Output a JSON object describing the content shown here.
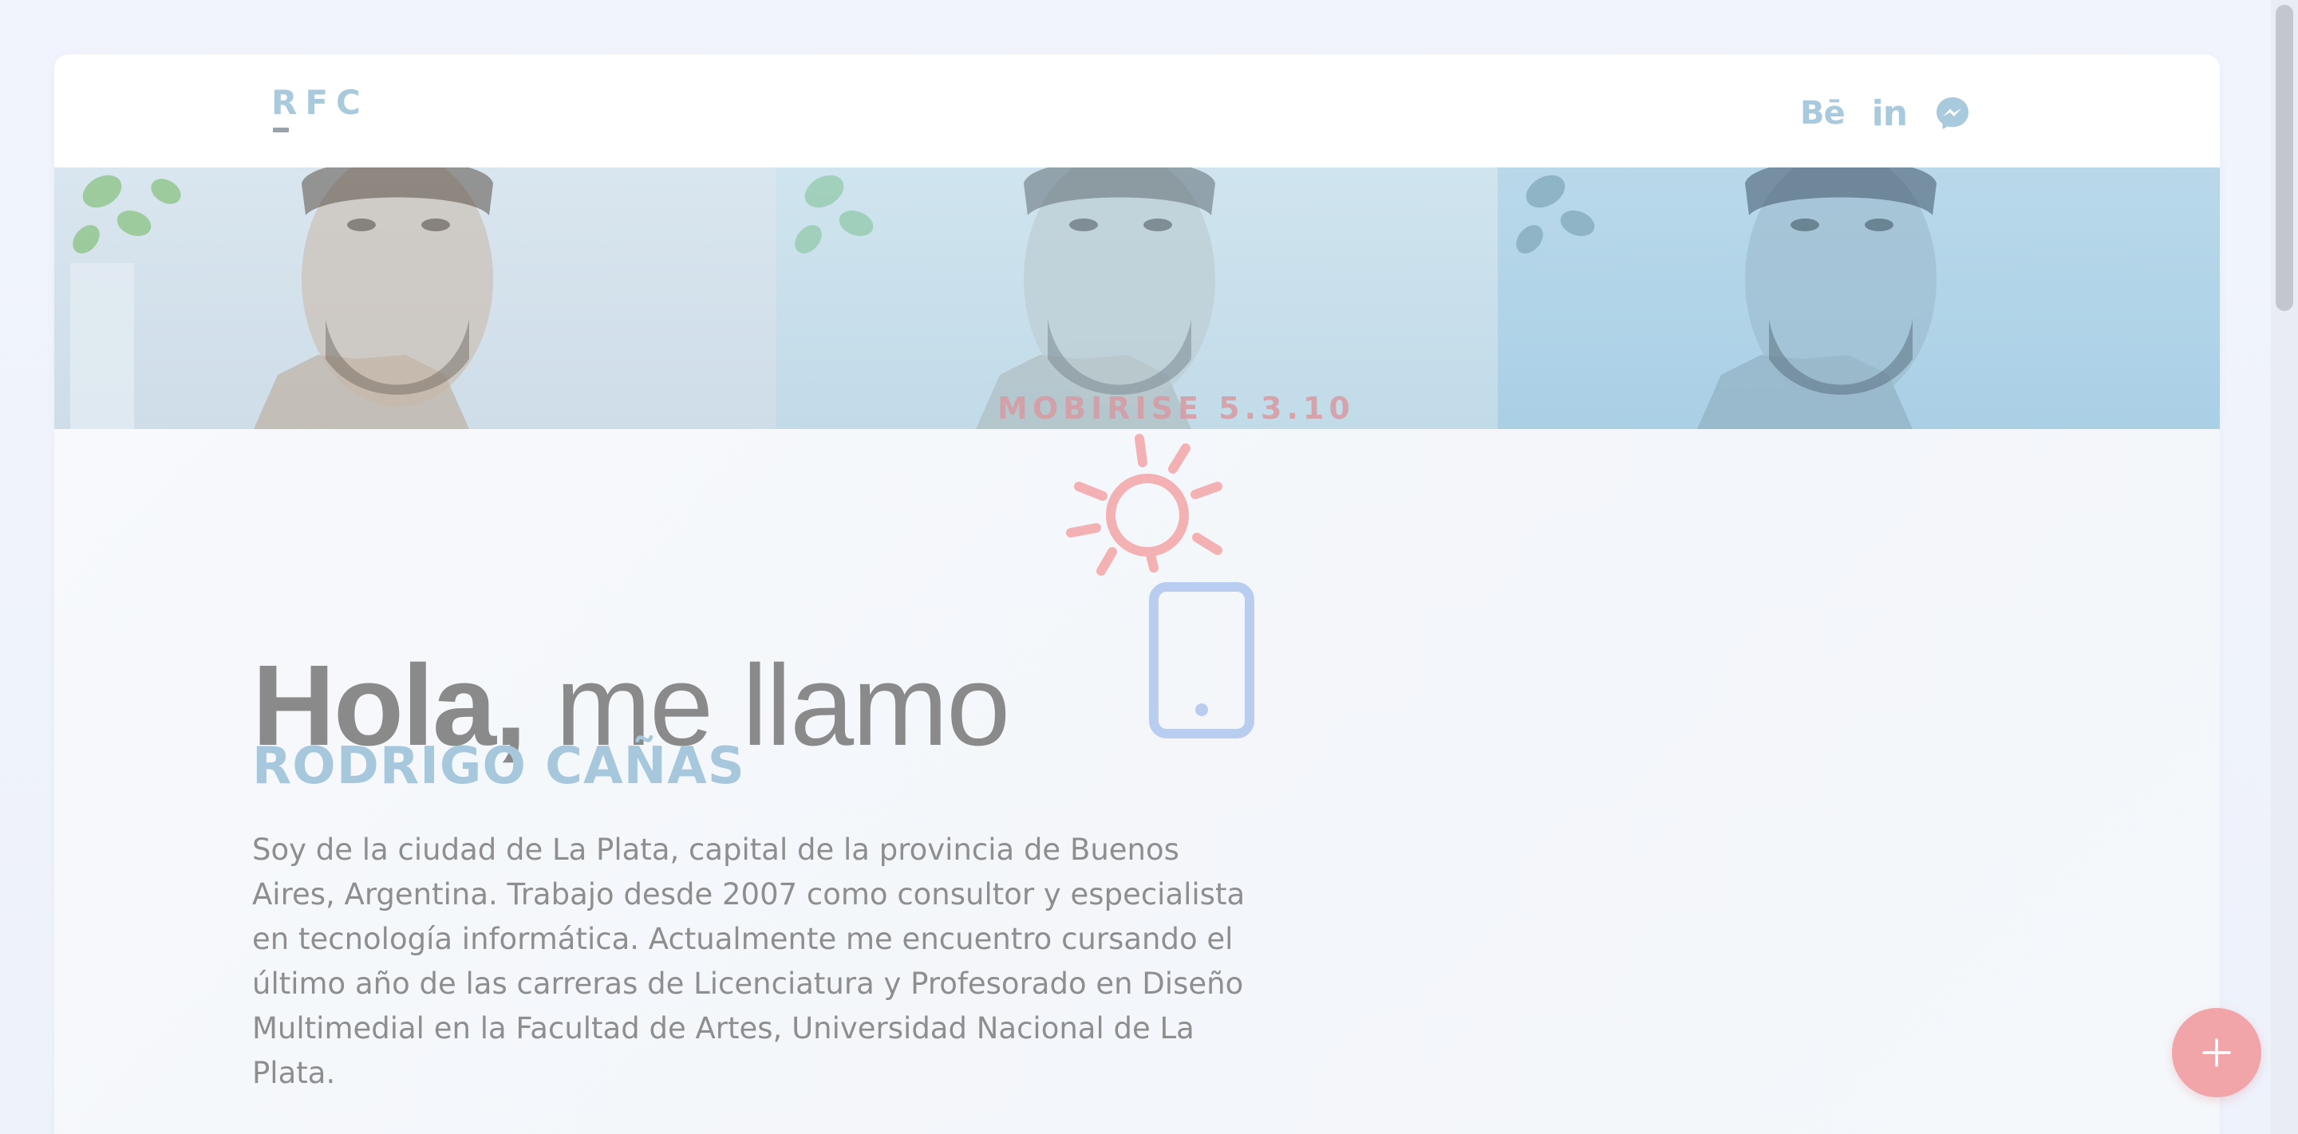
{
  "navbar": {
    "brand": "RFC",
    "social": [
      {
        "icon": "behance-icon",
        "label": "Bē"
      },
      {
        "icon": "linkedin-icon",
        "label": "in"
      },
      {
        "icon": "messenger-icon",
        "label": ""
      }
    ]
  },
  "overlay": {
    "mobirise_label": "MOBIRISE 5.3.10"
  },
  "hero": {
    "greeting_strong": "Hola,",
    "greeting_light": "me llamo",
    "name": "RODRIGO CAÑAS",
    "bio": "Soy de la ciudad de La Plata, capital de la provincia de Buenos Aires, Argentina. Trabajo desde 2007 como consultor y especialista en tecnología informática. Actualmente me encuentro cursando el último año de las carreras de Licenciatura y Profesorado en Diseño Multimedial en la Facultad de Artes, Universidad Nacional de La Plata."
  },
  "colors": {
    "accent": "#a9c9dd",
    "fab": "#f2a5a9",
    "text": "#8a8a8a"
  },
  "fab": {
    "icon": "plus-icon"
  }
}
